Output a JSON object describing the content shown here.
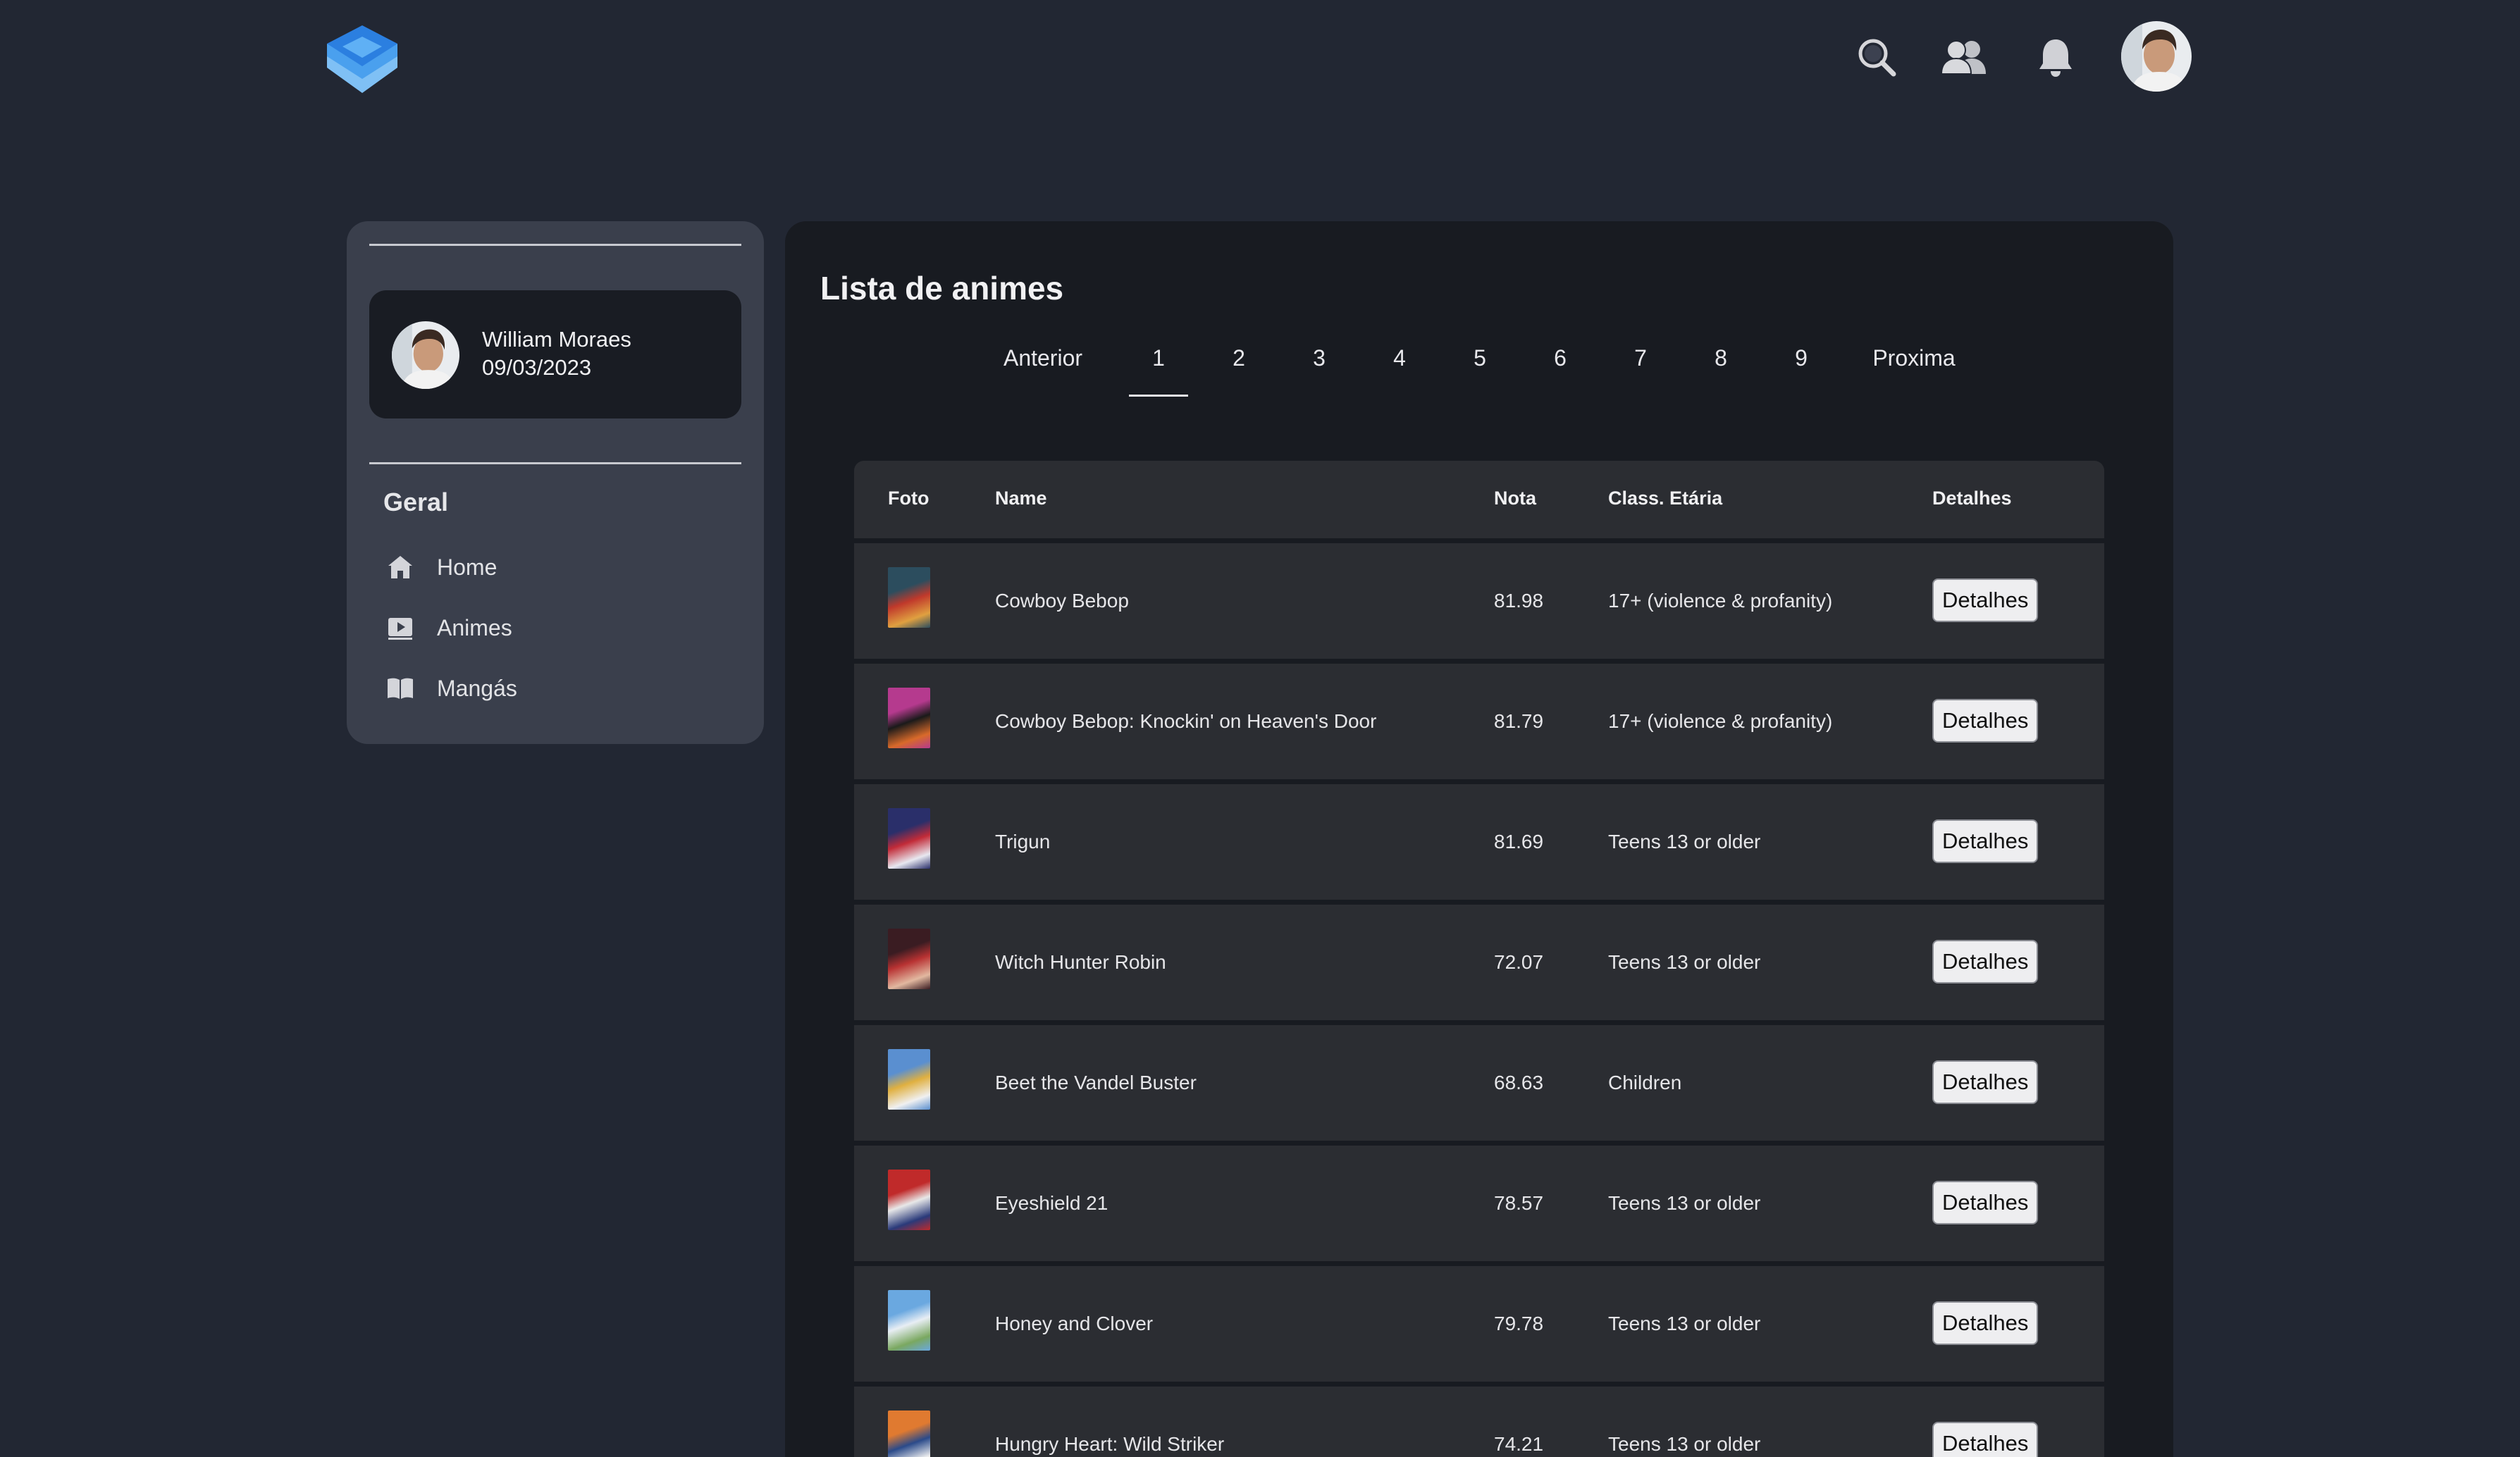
{
  "header": {
    "icons": [
      "search-icon",
      "friends-icon",
      "bell-icon"
    ]
  },
  "sidebar": {
    "profile": {
      "name": "William Moraes",
      "date": "09/03/2023"
    },
    "section_title": "Geral",
    "items": [
      {
        "label": "Home",
        "icon": "home-icon"
      },
      {
        "label": "Animes",
        "icon": "play-icon"
      },
      {
        "label": "Mangás",
        "icon": "book-icon"
      }
    ]
  },
  "main": {
    "title": "Lista de animes",
    "pagination": {
      "prev": "Anterior",
      "pages": [
        "1",
        "2",
        "3",
        "4",
        "5",
        "6",
        "7",
        "8",
        "9"
      ],
      "current": "1",
      "next": "Proxima"
    },
    "table": {
      "headers": [
        "Foto",
        "Name",
        "Nota",
        "Class. Etária",
        "Detalhes"
      ],
      "button_label": "Detalhes",
      "rows": [
        {
          "name": "Cowboy Bebop",
          "nota": "81.98",
          "class": "17+ (violence & profanity)",
          "thumb_colors": [
            "#2c4d5e",
            "#c0392b",
            "#e0a040"
          ]
        },
        {
          "name": "Cowboy Bebop: Knockin' on Heaven's Door",
          "nota": "81.79",
          "class": "17+ (violence & profanity)",
          "thumb_colors": [
            "#b53a8e",
            "#1a1a1a",
            "#d86a2a"
          ]
        },
        {
          "name": "Trigun",
          "nota": "81.69",
          "class": "Teens 13 or older",
          "thumb_colors": [
            "#2a2f6a",
            "#c22b38",
            "#e8e8f0"
          ]
        },
        {
          "name": "Witch Hunter Robin",
          "nota": "72.07",
          "class": "Teens 13 or older",
          "thumb_colors": [
            "#3a1c22",
            "#b83232",
            "#e2b8a0"
          ]
        },
        {
          "name": "Beet the Vandel Buster",
          "nota": "68.63",
          "class": "Children",
          "thumb_colors": [
            "#5a8fd0",
            "#e0b040",
            "#f0f0f0"
          ]
        },
        {
          "name": "Eyeshield 21",
          "nota": "78.57",
          "class": "Teens 13 or older",
          "thumb_colors": [
            "#c02a2a",
            "#e8e8e8",
            "#2a3a7a"
          ]
        },
        {
          "name": "Honey and Clover",
          "nota": "79.78",
          "class": "Teens 13 or older",
          "thumb_colors": [
            "#6aa8e0",
            "#e8eef4",
            "#7aa860"
          ]
        },
        {
          "name": "Hungry Heart: Wild Striker",
          "nota": "74.21",
          "class": "Teens 13 or older",
          "thumb_colors": [
            "#e07a30",
            "#2a4a8a",
            "#f0f0f0"
          ]
        }
      ]
    }
  }
}
